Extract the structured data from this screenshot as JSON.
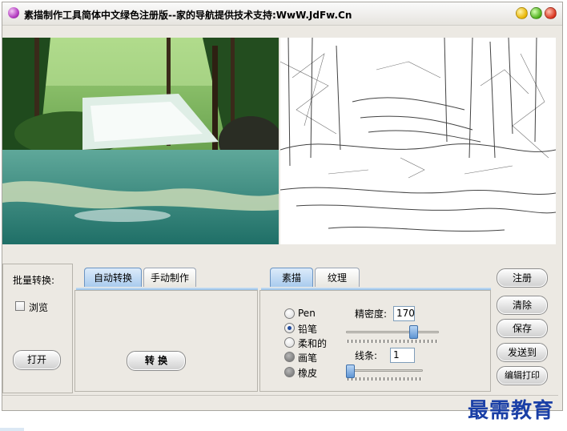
{
  "window": {
    "title": "素描制作工具简体中文绿色注册版--家的导航提供技术支持:WwW.JdFw.Cn"
  },
  "batch": {
    "label": "批量转换:",
    "browse_label": "浏览",
    "open_label": "打开"
  },
  "mode_tabs": [
    {
      "label": "自动转换",
      "active": true
    },
    {
      "label": "手动制作",
      "active": false
    }
  ],
  "convert_label": "转 换",
  "style_tabs": [
    {
      "label": "素描",
      "active": true
    },
    {
      "label": "纹理",
      "active": false
    }
  ],
  "brushes": [
    {
      "label": "Pen",
      "selected": false
    },
    {
      "label": "铅笔",
      "selected": true
    },
    {
      "label": "柔和的",
      "selected": false
    },
    {
      "label": "画笔",
      "selected": false
    },
    {
      "label": "橡皮",
      "selected": false
    }
  ],
  "precision": {
    "label": "精密度:",
    "value": "170",
    "level": 0.75
  },
  "lines": {
    "label": "线条:",
    "value": "1",
    "level": 0.0
  },
  "side_buttons": [
    "注册",
    "清除",
    "保存",
    "发送到",
    "编辑打印"
  ],
  "watermark": "最需教育",
  "colors": {
    "accent": "#6b94c3",
    "watermark": "#1a3fa6",
    "window_bg": "#ece9e3"
  }
}
